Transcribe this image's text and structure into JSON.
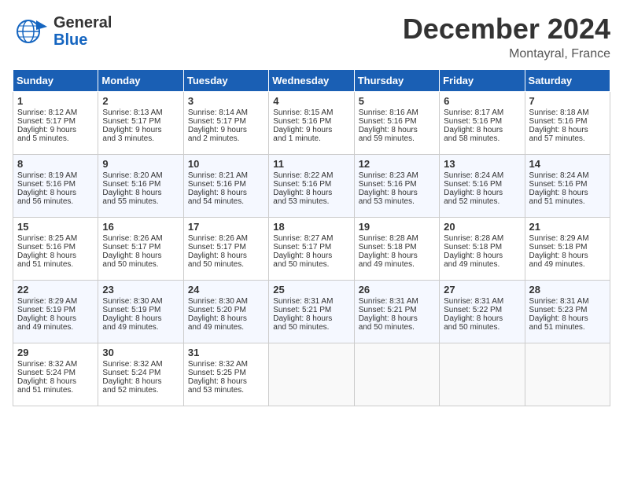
{
  "header": {
    "logo_general": "General",
    "logo_blue": "Blue",
    "month": "December 2024",
    "location": "Montayral, France"
  },
  "days_of_week": [
    "Sunday",
    "Monday",
    "Tuesday",
    "Wednesday",
    "Thursday",
    "Friday",
    "Saturday"
  ],
  "weeks": [
    [
      {
        "day": "1",
        "lines": [
          "Sunrise: 8:12 AM",
          "Sunset: 5:17 PM",
          "Daylight: 9 hours",
          "and 5 minutes."
        ]
      },
      {
        "day": "2",
        "lines": [
          "Sunrise: 8:13 AM",
          "Sunset: 5:17 PM",
          "Daylight: 9 hours",
          "and 3 minutes."
        ]
      },
      {
        "day": "3",
        "lines": [
          "Sunrise: 8:14 AM",
          "Sunset: 5:17 PM",
          "Daylight: 9 hours",
          "and 2 minutes."
        ]
      },
      {
        "day": "4",
        "lines": [
          "Sunrise: 8:15 AM",
          "Sunset: 5:16 PM",
          "Daylight: 9 hours",
          "and 1 minute."
        ]
      },
      {
        "day": "5",
        "lines": [
          "Sunrise: 8:16 AM",
          "Sunset: 5:16 PM",
          "Daylight: 8 hours",
          "and 59 minutes."
        ]
      },
      {
        "day": "6",
        "lines": [
          "Sunrise: 8:17 AM",
          "Sunset: 5:16 PM",
          "Daylight: 8 hours",
          "and 58 minutes."
        ]
      },
      {
        "day": "7",
        "lines": [
          "Sunrise: 8:18 AM",
          "Sunset: 5:16 PM",
          "Daylight: 8 hours",
          "and 57 minutes."
        ]
      }
    ],
    [
      {
        "day": "8",
        "lines": [
          "Sunrise: 8:19 AM",
          "Sunset: 5:16 PM",
          "Daylight: 8 hours",
          "and 56 minutes."
        ]
      },
      {
        "day": "9",
        "lines": [
          "Sunrise: 8:20 AM",
          "Sunset: 5:16 PM",
          "Daylight: 8 hours",
          "and 55 minutes."
        ]
      },
      {
        "day": "10",
        "lines": [
          "Sunrise: 8:21 AM",
          "Sunset: 5:16 PM",
          "Daylight: 8 hours",
          "and 54 minutes."
        ]
      },
      {
        "day": "11",
        "lines": [
          "Sunrise: 8:22 AM",
          "Sunset: 5:16 PM",
          "Daylight: 8 hours",
          "and 53 minutes."
        ]
      },
      {
        "day": "12",
        "lines": [
          "Sunrise: 8:23 AM",
          "Sunset: 5:16 PM",
          "Daylight: 8 hours",
          "and 53 minutes."
        ]
      },
      {
        "day": "13",
        "lines": [
          "Sunrise: 8:24 AM",
          "Sunset: 5:16 PM",
          "Daylight: 8 hours",
          "and 52 minutes."
        ]
      },
      {
        "day": "14",
        "lines": [
          "Sunrise: 8:24 AM",
          "Sunset: 5:16 PM",
          "Daylight: 8 hours",
          "and 51 minutes."
        ]
      }
    ],
    [
      {
        "day": "15",
        "lines": [
          "Sunrise: 8:25 AM",
          "Sunset: 5:16 PM",
          "Daylight: 8 hours",
          "and 51 minutes."
        ]
      },
      {
        "day": "16",
        "lines": [
          "Sunrise: 8:26 AM",
          "Sunset: 5:17 PM",
          "Daylight: 8 hours",
          "and 50 minutes."
        ]
      },
      {
        "day": "17",
        "lines": [
          "Sunrise: 8:26 AM",
          "Sunset: 5:17 PM",
          "Daylight: 8 hours",
          "and 50 minutes."
        ]
      },
      {
        "day": "18",
        "lines": [
          "Sunrise: 8:27 AM",
          "Sunset: 5:17 PM",
          "Daylight: 8 hours",
          "and 50 minutes."
        ]
      },
      {
        "day": "19",
        "lines": [
          "Sunrise: 8:28 AM",
          "Sunset: 5:18 PM",
          "Daylight: 8 hours",
          "and 49 minutes."
        ]
      },
      {
        "day": "20",
        "lines": [
          "Sunrise: 8:28 AM",
          "Sunset: 5:18 PM",
          "Daylight: 8 hours",
          "and 49 minutes."
        ]
      },
      {
        "day": "21",
        "lines": [
          "Sunrise: 8:29 AM",
          "Sunset: 5:18 PM",
          "Daylight: 8 hours",
          "and 49 minutes."
        ]
      }
    ],
    [
      {
        "day": "22",
        "lines": [
          "Sunrise: 8:29 AM",
          "Sunset: 5:19 PM",
          "Daylight: 8 hours",
          "and 49 minutes."
        ]
      },
      {
        "day": "23",
        "lines": [
          "Sunrise: 8:30 AM",
          "Sunset: 5:19 PM",
          "Daylight: 8 hours",
          "and 49 minutes."
        ]
      },
      {
        "day": "24",
        "lines": [
          "Sunrise: 8:30 AM",
          "Sunset: 5:20 PM",
          "Daylight: 8 hours",
          "and 49 minutes."
        ]
      },
      {
        "day": "25",
        "lines": [
          "Sunrise: 8:31 AM",
          "Sunset: 5:21 PM",
          "Daylight: 8 hours",
          "and 50 minutes."
        ]
      },
      {
        "day": "26",
        "lines": [
          "Sunrise: 8:31 AM",
          "Sunset: 5:21 PM",
          "Daylight: 8 hours",
          "and 50 minutes."
        ]
      },
      {
        "day": "27",
        "lines": [
          "Sunrise: 8:31 AM",
          "Sunset: 5:22 PM",
          "Daylight: 8 hours",
          "and 50 minutes."
        ]
      },
      {
        "day": "28",
        "lines": [
          "Sunrise: 8:31 AM",
          "Sunset: 5:23 PM",
          "Daylight: 8 hours",
          "and 51 minutes."
        ]
      }
    ],
    [
      {
        "day": "29",
        "lines": [
          "Sunrise: 8:32 AM",
          "Sunset: 5:24 PM",
          "Daylight: 8 hours",
          "and 51 minutes."
        ]
      },
      {
        "day": "30",
        "lines": [
          "Sunrise: 8:32 AM",
          "Sunset: 5:24 PM",
          "Daylight: 8 hours",
          "and 52 minutes."
        ]
      },
      {
        "day": "31",
        "lines": [
          "Sunrise: 8:32 AM",
          "Sunset: 5:25 PM",
          "Daylight: 8 hours",
          "and 53 minutes."
        ]
      },
      null,
      null,
      null,
      null
    ]
  ]
}
